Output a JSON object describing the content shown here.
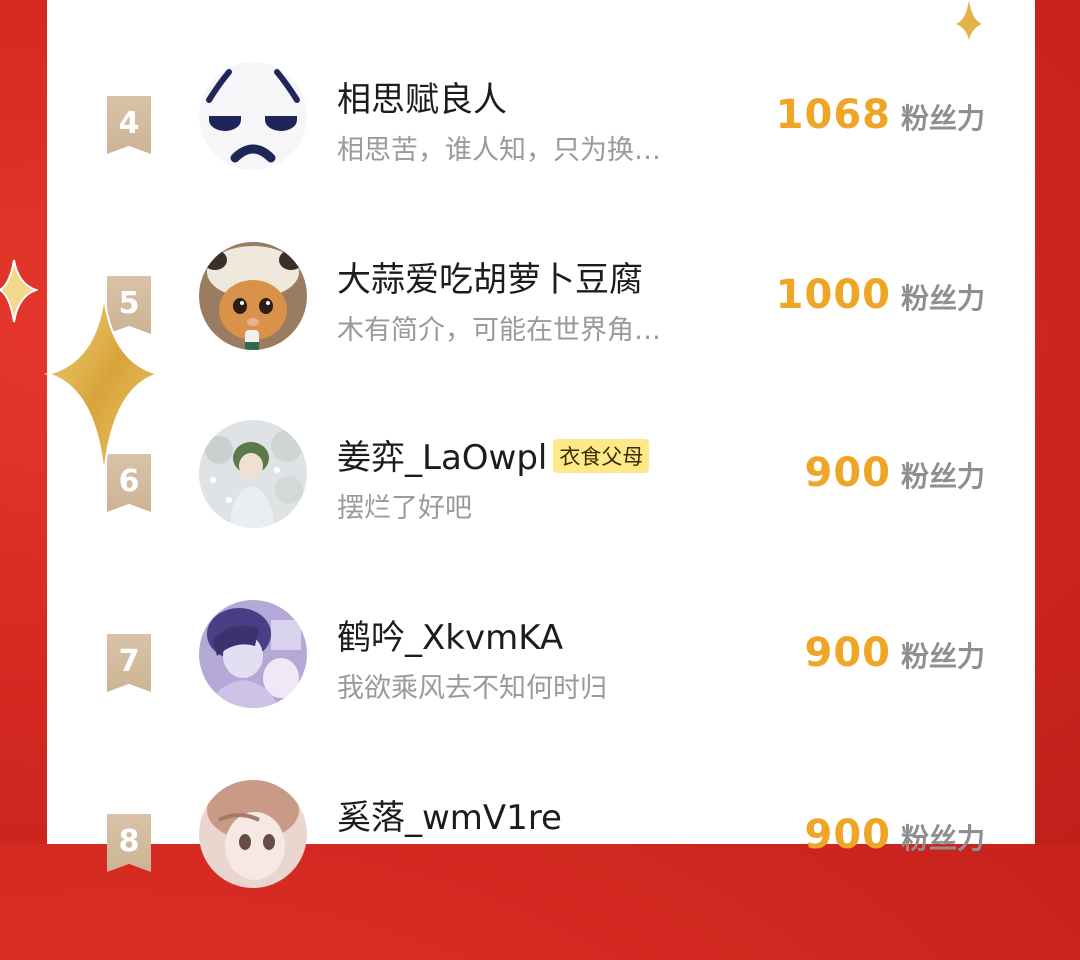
{
  "colors": {
    "background_red": "#d52a22",
    "panel": "#ffffff",
    "rank_badge": "#d2b999",
    "score": "#efa525",
    "tag_bg": "#ffe88a",
    "sparkle_gold": "#e8b84a"
  },
  "leaderboard": {
    "rows": [
      {
        "rank": "4",
        "name": "相思赋良人",
        "tag": "",
        "bio": "相思苦，谁人知，只为换…",
        "score": "1068",
        "unit": "粉丝力",
        "avatar": "pouting-face-avatar"
      },
      {
        "rank": "5",
        "name": "大蒜爱吃胡萝卜豆腐",
        "tag": "",
        "bio": "木有简介，可能在世界角…",
        "score": "1000",
        "unit": "粉丝力",
        "avatar": "cat-avatar"
      },
      {
        "rank": "6",
        "name": "姜弈_LaOwpl",
        "tag": "衣食父母",
        "bio": "摆烂了好吧",
        "score": "900",
        "unit": "粉丝力",
        "avatar": "anime-boy-snow-avatar"
      },
      {
        "rank": "7",
        "name": "鹤吟_XkvmKA",
        "tag": "",
        "bio": "我欲乘风去不知何时归",
        "score": "900",
        "unit": "粉丝力",
        "avatar": "anime-couple-purple-avatar"
      },
      {
        "rank": "8",
        "name": "奚落_wmV1re",
        "tag": "",
        "bio": "",
        "score": "900",
        "unit": "粉丝力",
        "avatar": "anime-girl-avatar"
      }
    ]
  }
}
